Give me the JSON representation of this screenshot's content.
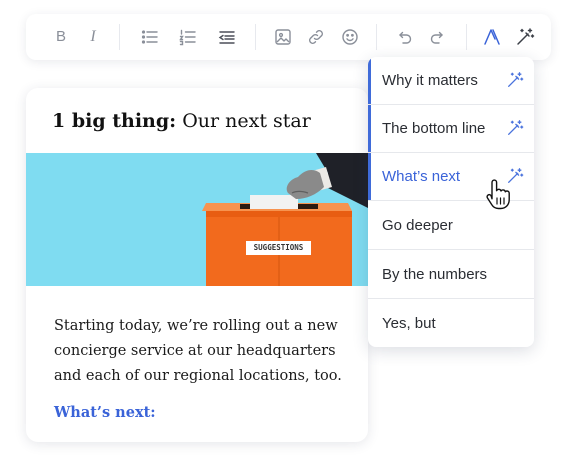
{
  "toolbar": {
    "buttons": [
      {
        "name": "bold-icon",
        "glyph": "B"
      },
      {
        "name": "italic-icon",
        "glyph": "I"
      },
      {
        "name": "bullet-list-icon"
      },
      {
        "name": "numbered-list-icon"
      },
      {
        "name": "outdent-icon"
      },
      {
        "name": "image-icon"
      },
      {
        "name": "link-icon"
      },
      {
        "name": "emoji-icon"
      },
      {
        "name": "undo-icon"
      },
      {
        "name": "redo-icon"
      },
      {
        "name": "brand-logo-icon"
      },
      {
        "name": "magic-wand-icon"
      }
    ],
    "bold_glyph": "B",
    "italic_glyph": "I",
    "accent_color": "#3a63d8"
  },
  "card": {
    "headline_bold": "1 big thing:",
    "headline_rest": "Our next star",
    "hero_sign": "SUGGESTIONS",
    "body": "Starting today, we’re rolling out a new concierge service at our headquarters and each of our regional locations, too.",
    "whats_next": "What’s next:"
  },
  "menu": {
    "items": [
      {
        "label": "Why it matters",
        "has_wand": true,
        "accent": true,
        "active": false
      },
      {
        "label": "The bottom line",
        "has_wand": true,
        "accent": true,
        "active": false
      },
      {
        "label": "What’s next",
        "has_wand": true,
        "accent": true,
        "active": true
      },
      {
        "label": "Go deeper",
        "has_wand": false,
        "accent": false,
        "active": false
      },
      {
        "label": "By the numbers",
        "has_wand": false,
        "accent": false,
        "active": false
      },
      {
        "label": "Yes, but",
        "has_wand": false,
        "accent": false,
        "active": false
      }
    ]
  },
  "colors": {
    "hero_bg": "#7fdcf1",
    "box_orange": "#f26a1d",
    "link_blue": "#3a63d8"
  }
}
